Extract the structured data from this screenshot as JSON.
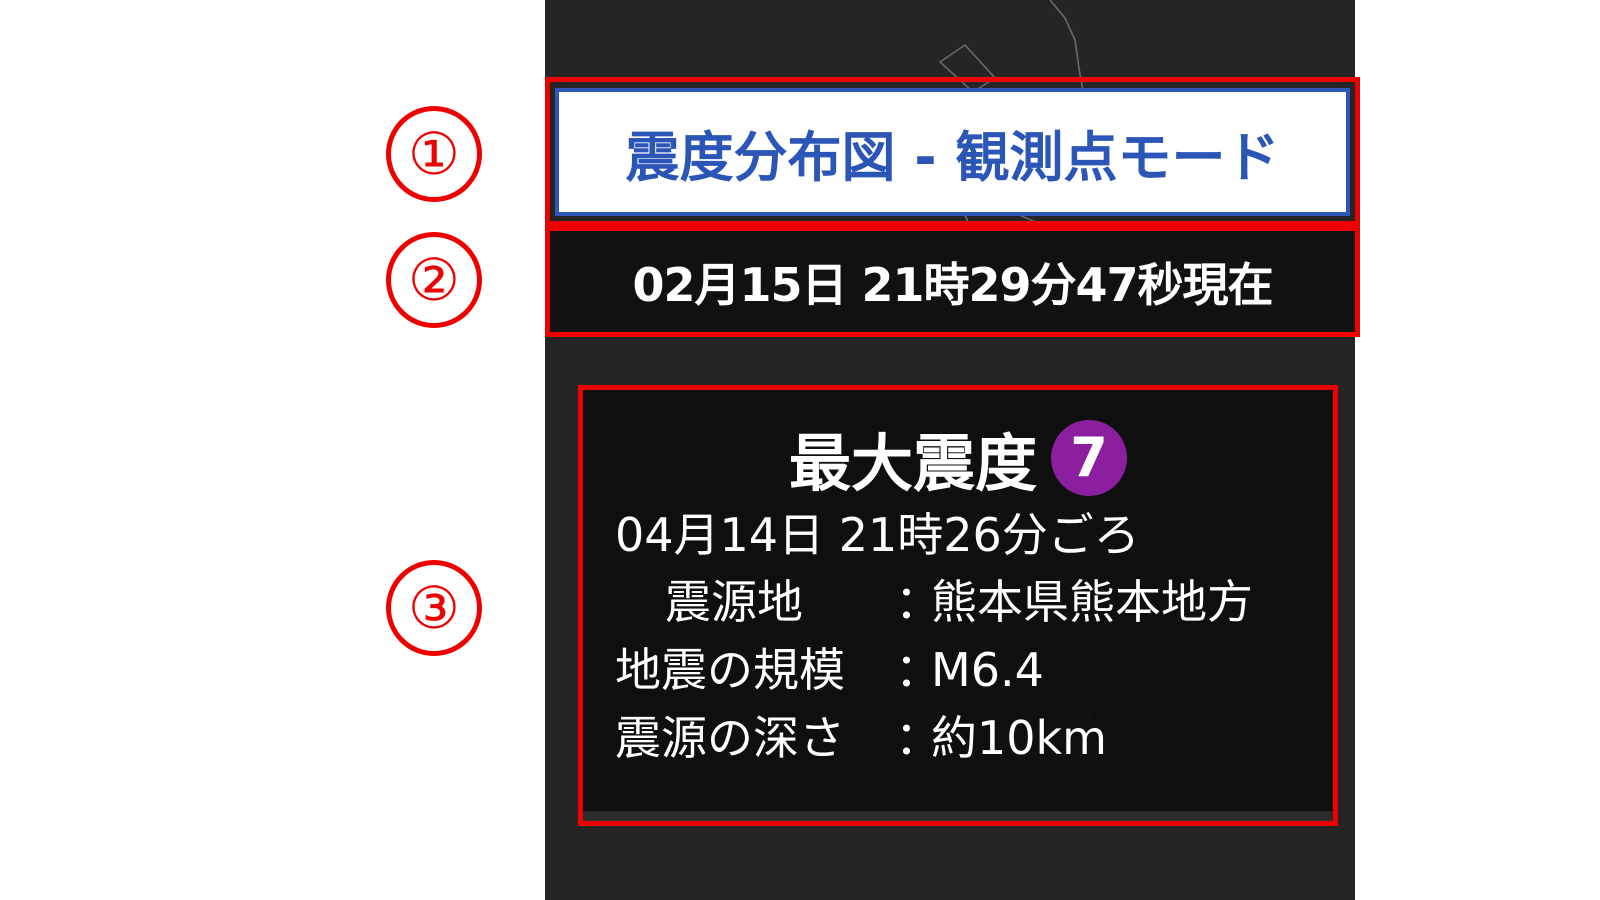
{
  "annotations": {
    "callouts": [
      "①",
      "②",
      "③"
    ]
  },
  "header": {
    "title": "震度分布図 - 観測点モード"
  },
  "timestamp": {
    "text": "02月15日 21時29分47秒現在"
  },
  "summary": {
    "max_intensity_label": "最大震度",
    "max_intensity_value": "7",
    "max_intensity_color": "#8c1ea0",
    "occurred_at": "04月14日 21時26分ごろ",
    "rows": [
      {
        "key": "震源地",
        "sep": "：",
        "value": "熊本県熊本地方"
      },
      {
        "key": "地震の規模",
        "sep": "：",
        "value": "M6.4"
      },
      {
        "key": "震源の深さ",
        "sep": "：",
        "value": "約10km"
      }
    ]
  },
  "colors": {
    "title_blue": "#2b55b7",
    "annotation_red": "#ee0000",
    "map_background": "#252525"
  }
}
